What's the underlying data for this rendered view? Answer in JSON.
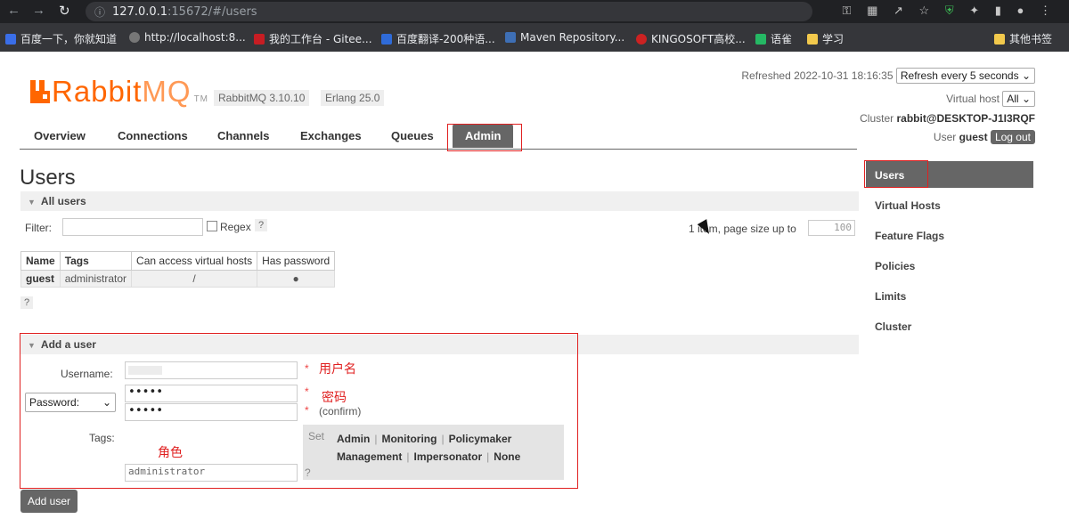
{
  "browser": {
    "url_host": "127.0.0.1",
    "url_port": ":15672",
    "url_path": "/#/users",
    "bookmarks": [
      {
        "label": "百度一下，你就知道",
        "color": "#3a6ee8"
      },
      {
        "label": "http://localhost:8...",
        "color": "#777777"
      },
      {
        "label": "我的工作台 - Gitee...",
        "color": "#c71d23"
      },
      {
        "label": "百度翻译-200种语...",
        "color": "#2f6bd8"
      },
      {
        "label": "Maven Repository...",
        "color": "#3e6fb5"
      },
      {
        "label": "KINGOSOFT高校...",
        "color": "#cc2222"
      },
      {
        "label": "语雀",
        "color": "#25b864"
      },
      {
        "label": "学习",
        "color": "#f2c94c"
      },
      {
        "label": "其他书签",
        "color": "#f2c94c"
      }
    ]
  },
  "header": {
    "logo_main": "Rabbit",
    "logo_mq": "MQ",
    "logo_tm": "TM",
    "version": "RabbitMQ 3.10.10",
    "erlang": "Erlang 25.0",
    "refreshed": "Refreshed 2022-10-31 18:16:35",
    "refresh_select": "Refresh every 5 seconds",
    "vhost_label": "Virtual host",
    "vhost_select": "All",
    "cluster_label": "Cluster",
    "cluster_name": "rabbit@DESKTOP-J1I3RQF",
    "user_label": "User",
    "user_name": "guest",
    "logout": "Log out"
  },
  "tabs": [
    "Overview",
    "Connections",
    "Channels",
    "Exchanges",
    "Queues",
    "Admin"
  ],
  "main": {
    "title": "Users",
    "all_users": "All users",
    "filter_label": "Filter:",
    "regex_label": "Regex",
    "help": "?",
    "pagination_text": "1 item, page size up to",
    "page_size": "100",
    "table": {
      "headers": [
        "Name",
        "Tags",
        "Can access virtual hosts",
        "Has password"
      ],
      "rows": [
        [
          "guest",
          "administrator",
          "/",
          "●"
        ]
      ]
    },
    "add_user": {
      "title": "Add a user",
      "username_label": "Username:",
      "password_select": "Password:",
      "password_mask": "•••••",
      "confirm_mask": "•••••",
      "confirm_label": "(confirm)",
      "tags_label": "Tags:",
      "tags_value": "administrator",
      "set_label": "Set",
      "tag_links": [
        "Admin",
        "Monitoring",
        "Policymaker",
        "Management",
        "Impersonator",
        "None"
      ],
      "required_star": "*",
      "submit": "Add user"
    }
  },
  "annotations": {
    "username": "用户名",
    "password": "密码",
    "role": "角色"
  },
  "sidebar": [
    "Users",
    "Virtual Hosts",
    "Feature Flags",
    "Policies",
    "Limits",
    "Cluster"
  ]
}
